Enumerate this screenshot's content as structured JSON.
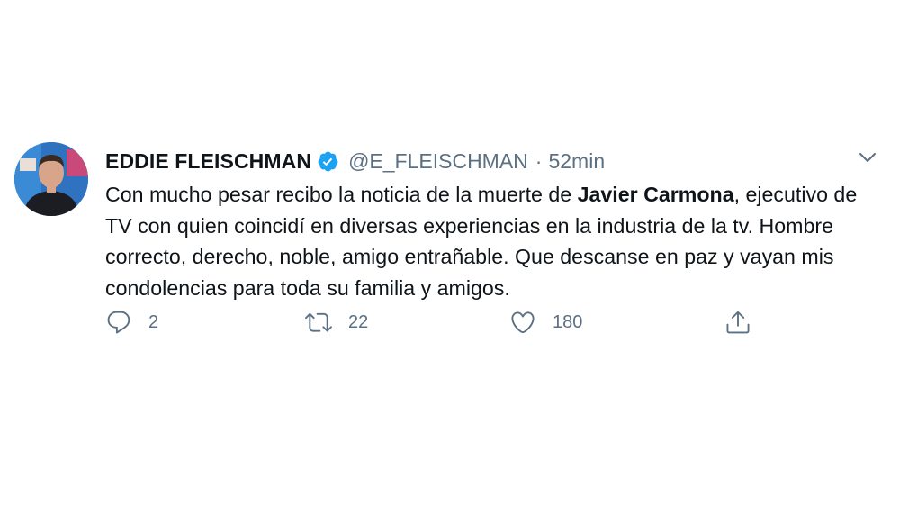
{
  "tweet": {
    "display_name": "EDDIE FLEISCHMAN",
    "handle": "@E_FLEISCHMAN",
    "separator": "·",
    "time": "52min",
    "text_part1": "Con mucho pesar recibo la noticia de la muerte de ",
    "text_bold": "Javier Carmona",
    "text_part2": ", ejecutivo de TV con quien coincidí en diversas experiencias en la industria de la tv. Hombre correcto, derecho, noble, amigo entrañable. Que descanse en paz y vayan mis condolencias para toda su familia y amigos.",
    "replies": "2",
    "retweets": "22",
    "likes": "180"
  },
  "icons": {
    "verified": "verified-badge-icon",
    "more": "chevron-down-icon",
    "reply": "reply-icon",
    "retweet": "retweet-icon",
    "like": "heart-icon",
    "share": "share-icon"
  },
  "colors": {
    "verified": "#1da1f2",
    "secondary_text": "#5b7083",
    "primary_text": "#0f1419"
  }
}
